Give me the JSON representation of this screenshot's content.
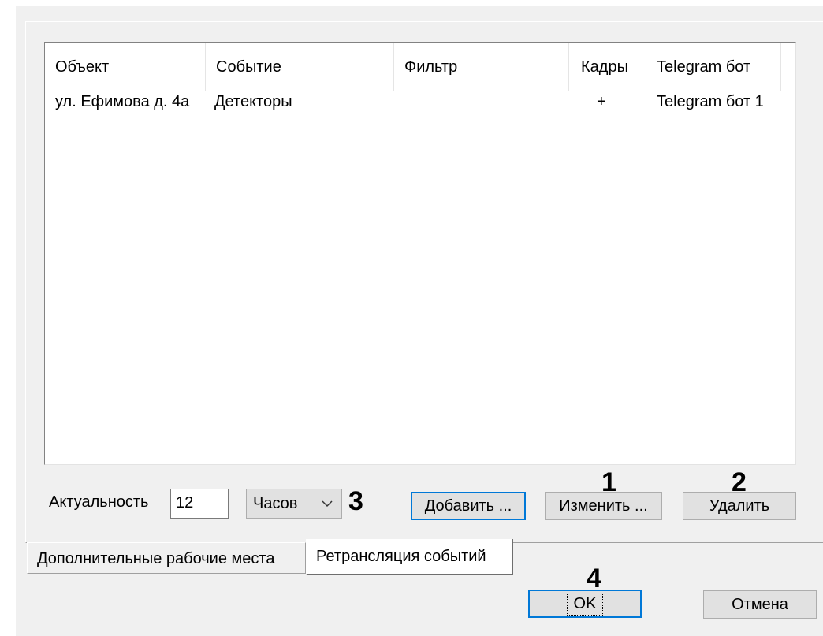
{
  "listview": {
    "columns": [
      "Объект",
      "Событие",
      "Фильтр",
      "Кадры",
      "Telegram бот"
    ],
    "rows": [
      {
        "object": "ул. Ефимова д. 4а",
        "event": "Детекторы",
        "filter": "",
        "frames": "+",
        "bot": "Telegram бот 1"
      }
    ]
  },
  "actuality": {
    "label": "Актуальность",
    "value": "12",
    "unit": "Часов"
  },
  "buttons": {
    "add": "Добавить ...",
    "edit": "Изменить ...",
    "delete": "Удалить",
    "ok": "OK",
    "cancel": "Отмена"
  },
  "markers": [
    "1",
    "2",
    "3",
    "4"
  ],
  "tabs": {
    "inactive": "Дополнительные рабочие места",
    "active": "Ретрансляция событий"
  },
  "colors": {
    "dialog_bg": "#f0f0f0",
    "button_bg": "#e1e1e1",
    "focus_border": "#0078d7"
  }
}
